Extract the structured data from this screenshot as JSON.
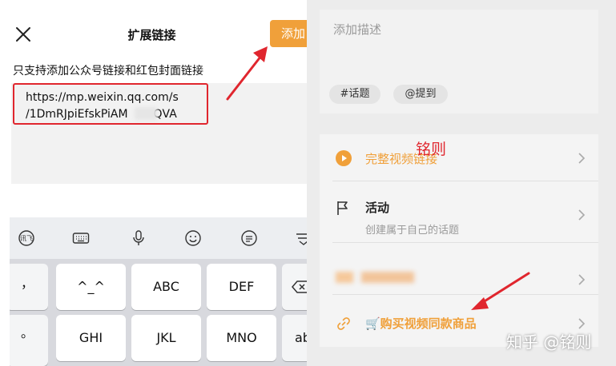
{
  "left": {
    "title": "扩展链接",
    "add_label": "添加",
    "hint": "只支持添加公众号链接和红包封面链接",
    "link_line1": "https://mp.weixin.qq.com/s",
    "link_line2": "/1DmRJpiEfskPiAM",
    "link_tail": "QVA"
  },
  "keyboard": {
    "tools": [
      "pinyin-logo-icon",
      "keyboard-icon",
      "microphone-icon",
      "emoji-icon",
      "bubble-icon",
      "collapse-icon"
    ],
    "keys_row1": [
      "^_^",
      "ABC",
      "DEF"
    ],
    "keys_row2": [
      "GHI",
      "JKL",
      "MNO"
    ],
    "side_keys": [
      "，",
      "。"
    ],
    "edge_label": "ab"
  },
  "right": {
    "desc_placeholder": "添加描述",
    "chips": [
      "#话题",
      "@提到"
    ],
    "rows": {
      "full_video": "完整视频链接",
      "activity_title": "活动",
      "activity_sub": "创建属于自己的话题",
      "buy": "🛒购买视频同款商品"
    },
    "annotation": "铭则",
    "watermark": "知乎 @铭则"
  },
  "colors": {
    "accent_orange": "#f0a03a",
    "highlight_red": "#e0262e",
    "panel_gray": "#ececec"
  }
}
